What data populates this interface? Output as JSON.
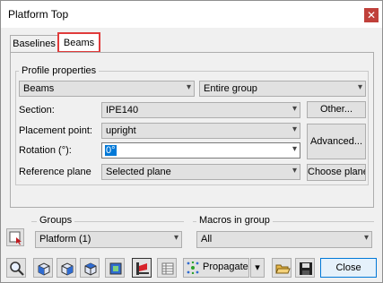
{
  "window": {
    "title": "Platform Top",
    "close_glyph": "✕"
  },
  "tabs": [
    {
      "label": "Baselines",
      "active": false
    },
    {
      "label": "Beams",
      "active": true
    }
  ],
  "profile_properties": {
    "group_label": "Profile properties",
    "type_value": "Beams",
    "scope_value": "Entire group",
    "section": {
      "label": "Section:",
      "value": "IPE140",
      "other_button": "Other..."
    },
    "placement_point": {
      "label": "Placement point:",
      "value": "upright"
    },
    "advanced_button": "Advanced...",
    "rotation": {
      "label": "Rotation (°):",
      "value": "0°"
    },
    "reference_plane": {
      "label": "Reference plane",
      "value": "Selected plane",
      "choose_button": "Choose plane"
    }
  },
  "groups": {
    "label": "Groups",
    "value": "Platform (1)"
  },
  "macros": {
    "label": "Macros in group",
    "value": "All"
  },
  "toolbar": {
    "propagate_label": "Propagate",
    "close_label": "Close",
    "icons": [
      "zoom-search-icon",
      "cube-front-icon",
      "cube-side-icon",
      "cube-top-icon",
      "cube-view-icon",
      "beam-flag-icon",
      "table-icon",
      "propagate-icon",
      "folder-open-icon",
      "save-icon"
    ]
  },
  "colors": {
    "highlight": "#e03b3b",
    "selection": "#0078d7",
    "accent_blue": "#2f6bd1"
  }
}
